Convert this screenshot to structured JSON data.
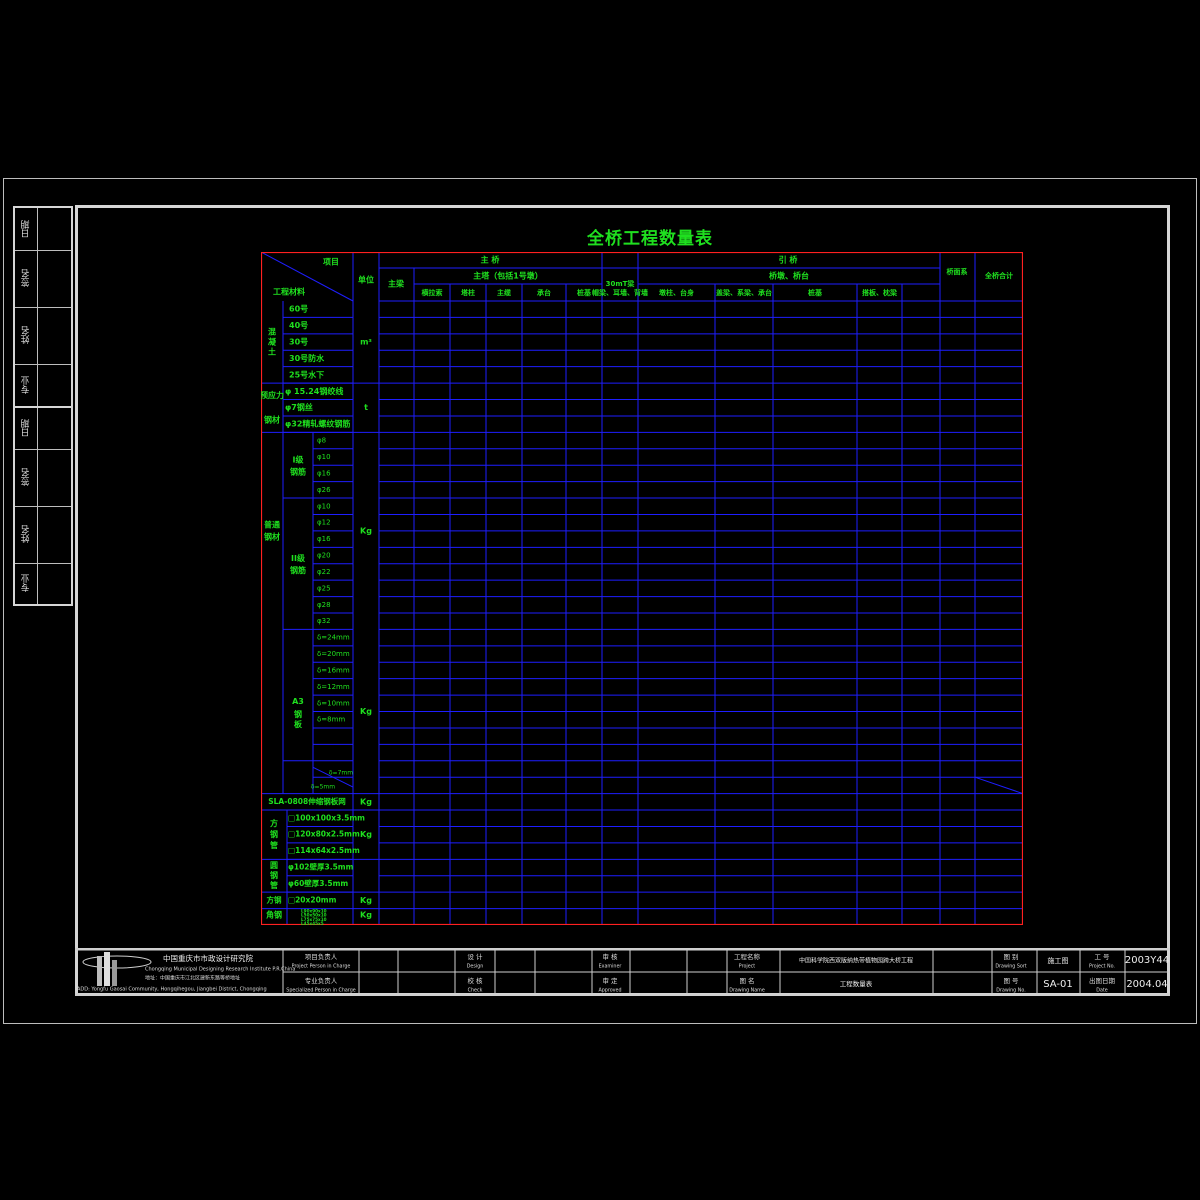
{
  "title": "全桥工程数量表",
  "sidebar": {
    "cells": [
      "日期",
      "签名",
      "姓名",
      "专业",
      "日期",
      "签名",
      "姓名",
      "专业"
    ]
  },
  "table": {
    "corner": {
      "top": "项目",
      "bottom": "工程材料"
    },
    "unit_header": "单位",
    "main_bridge": "主  桥",
    "main_beam": "主梁",
    "main_tower": "主塔（包括1号墩）",
    "tower_subs": [
      "横拉索",
      "塔柱",
      "主缆",
      "承台",
      "桩基"
    ],
    "approach": "引  桥",
    "t_beam": "30mT梁",
    "pier_group": "桥墩、桥台",
    "pier_subs": [
      "帽梁、耳墙、背墙",
      "墩柱、台身",
      "盖梁、系梁、承台",
      "桩基",
      "搭板、枕梁"
    ],
    "bridge_deck": "桥面系",
    "total": "全桥合计",
    "groups": [
      {
        "name": "混凝土",
        "unit": "m³",
        "items": [
          "60号",
          "40号",
          "30号",
          "30号防水",
          "25号水下"
        ]
      },
      {
        "name": "预应力钢材",
        "unit": "t",
        "items": [
          "φ 15.24钢绞线",
          "φ7钢丝",
          "φ32精轧螺纹钢筋"
        ]
      }
    ],
    "rebar_label": "普通钢材",
    "rebar_unit": "Kg",
    "grade1": {
      "name": "I级钢筋",
      "items": [
        "φ8",
        "φ10",
        "φ16",
        "φ26"
      ]
    },
    "grade2": {
      "name": "II级钢筋",
      "items": [
        "φ10",
        "φ12",
        "φ16",
        "φ20",
        "φ22",
        "φ25",
        "φ28",
        "φ32"
      ]
    },
    "plate": {
      "name": "A3钢板",
      "unit": "Kg",
      "items": [
        "δ=24mm",
        "δ=20mm",
        "δ=16mm",
        "δ=12mm",
        "δ=10mm",
        "δ=8mm"
      ],
      "diag_a": "δ=7mm",
      "diag_b": "δ=5mm"
    },
    "joint": {
      "name": "SLA-0808伸缩钢板网",
      "unit": "Kg"
    },
    "square_tube": {
      "name": "方钢管",
      "unit": "Kg",
      "items": [
        "□100x100x3.5mm",
        "□120x80x2.5mm",
        "□114x64x2.5mm"
      ]
    },
    "round_tube": {
      "name": "圆钢管",
      "items": [
        "φ102壁厚3.5mm",
        "φ60壁厚3.5mm"
      ]
    },
    "square_steel": {
      "name": "方钢",
      "unit": "Kg",
      "item": "□20x20mm"
    },
    "angle": {
      "name": "角钢",
      "unit": "Kg",
      "items": [
        "L90x90x10",
        "L50x50x10",
        "L75x75x10",
        "L45x45x5"
      ]
    }
  },
  "titleblock": {
    "company_cn": "中国重庆市市政设计研究院",
    "company_en": "Chongqing Municipal Designing Research Institute P.R.China",
    "addr_cn": "地址：中国重庆市江北区建新东路等桥地址",
    "addr_en": "ADD: Yongfu Gaosai Community, Hongqihegou, Jiangbei District, Chongqing",
    "proj_head_cn": "项目负责人",
    "proj_head_en": "Project Person in Charge",
    "spec_head_cn": "专业负责人",
    "spec_head_en": "Specialized Person in Charge",
    "design_cn": "设  计",
    "design_en": "Design",
    "check_cn": "校  核",
    "check_en": "Check",
    "exam_cn": "审  核",
    "exam_en": "Examiner",
    "approve_cn": "审  定",
    "approve_en": "Approved",
    "project_cn": "工程名称",
    "project_en": "Project",
    "project_name": "中国科学院西双版纳热带植物园跨大桥工程",
    "drawing_name_cn": "图  名",
    "drawing_name_en": "Drawing Name",
    "drawing_name": "工程数量表",
    "sort_cn": "图  别",
    "sort_en": "Drawing Sort",
    "sort_value": "施工图",
    "drawing_no_cn": "图  号",
    "drawing_no_en": "Drawing No.",
    "drawing_no": "SA-01",
    "proj_no_cn": "工  号",
    "proj_no_en": "Project No.",
    "proj_no": "2003Y44",
    "date_cn": "出图日期",
    "date_en": "Date",
    "date": "2004.04"
  },
  "colors": {
    "grid": "#1e1eff",
    "border": "#ff2020",
    "text": "#1fe01f",
    "frame": "#d6d6d6"
  }
}
